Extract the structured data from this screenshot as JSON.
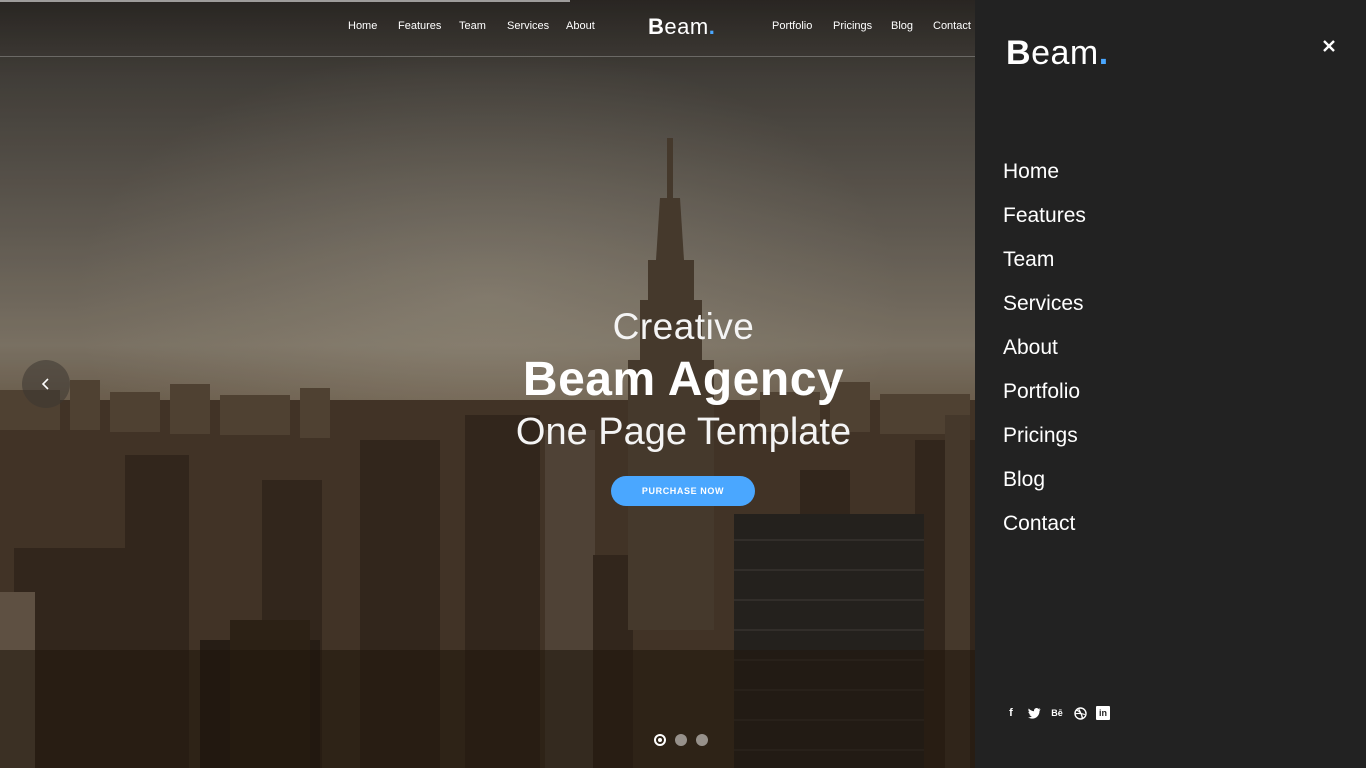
{
  "topnav": {
    "left_links": [
      "Home",
      "Features",
      "Team",
      "Services",
      "About"
    ],
    "right_links": [
      "Portfolio",
      "Pricings",
      "Blog",
      "Contact"
    ],
    "logo": {
      "bold": "B",
      "thin": "eam",
      "dot": "."
    }
  },
  "hero": {
    "line1": "Creative",
    "line2": "Beam Agency",
    "line3": "One Page Template",
    "cta_label": "PURCHASE NOW",
    "prev_icon": "chevron-left-icon",
    "slides": {
      "count": 3,
      "active_index": 0
    }
  },
  "side_menu": {
    "logo": {
      "bold": "B",
      "thin": "eam",
      "dot": "."
    },
    "close_icon": "close-icon",
    "items": [
      "Home",
      "Features",
      "Team",
      "Services",
      "About",
      "Portfolio",
      "Pricings",
      "Blog",
      "Contact"
    ],
    "social": [
      {
        "icon": "facebook-icon",
        "glyph": "f"
      },
      {
        "icon": "twitter-icon",
        "glyph": ""
      },
      {
        "icon": "behance-icon",
        "glyph": "Bē"
      },
      {
        "icon": "dribbble-icon",
        "glyph": ""
      },
      {
        "icon": "linkedin-icon",
        "glyph": "in"
      }
    ]
  },
  "colors": {
    "accent": "#4aa7ff",
    "panel_bg": "#222222"
  }
}
